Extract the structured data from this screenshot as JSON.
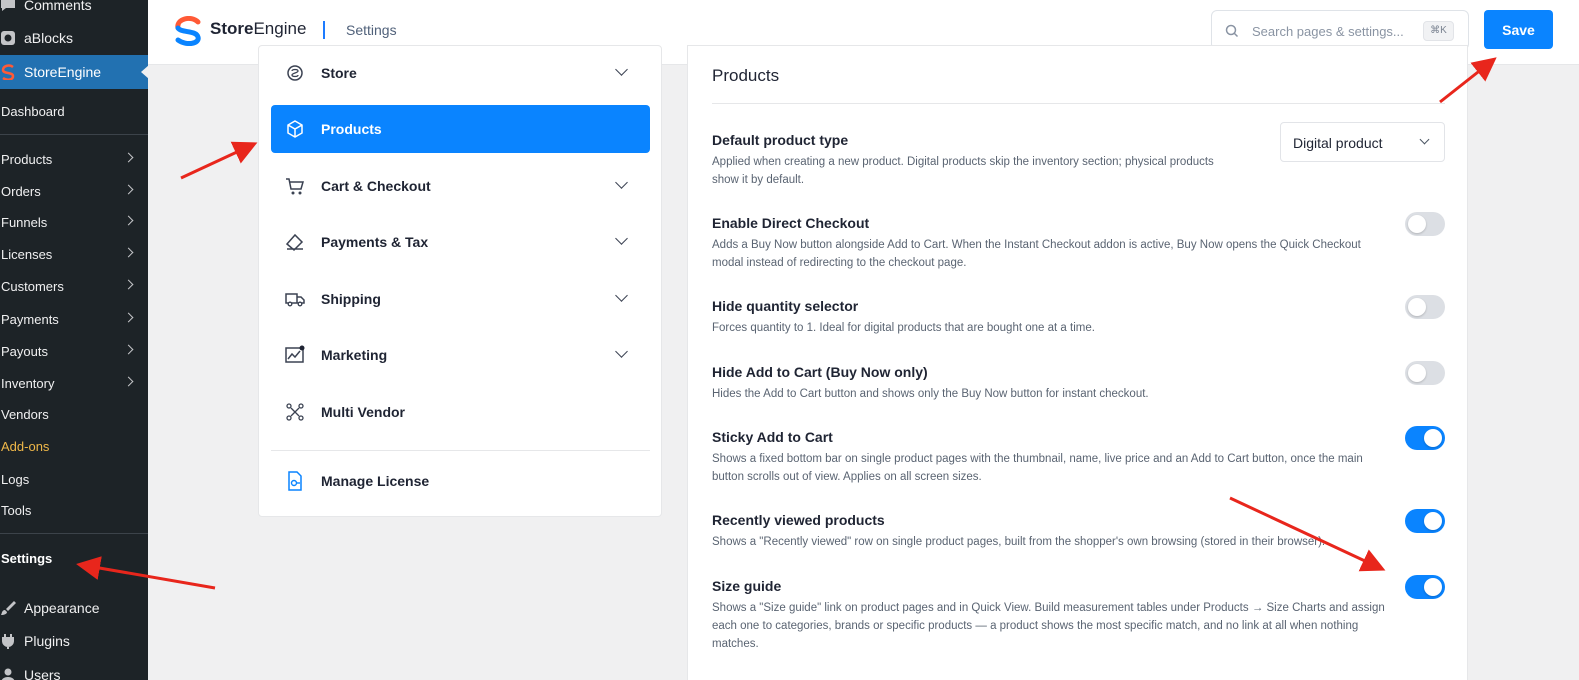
{
  "wp_menu": {
    "comments": "Comments",
    "ablocks": "aBlocks",
    "storeengine": "StoreEngine",
    "dashboard": "Dashboard",
    "products": "Products",
    "orders": "Orders",
    "funnels": "Funnels",
    "licenses": "Licenses",
    "customers": "Customers",
    "payments": "Payments",
    "payouts": "Payouts",
    "inventory": "Inventory",
    "vendors": "Vendors",
    "addons": "Add-ons",
    "logs": "Logs",
    "tools": "Tools",
    "settings": "Settings",
    "appearance": "Appearance",
    "plugins": "Plugins",
    "users": "Users"
  },
  "header": {
    "logo_bold": "Store",
    "logo_rest": "Engine",
    "breadcrumb": "Settings",
    "search_placeholder": "Search pages & settings...",
    "search_shortcut": "⌘K",
    "save_label": "Save"
  },
  "nav": {
    "store": "Store",
    "products": "Products",
    "cart_checkout": "Cart & Checkout",
    "payments_tax": "Payments & Tax",
    "shipping": "Shipping",
    "marketing": "Marketing",
    "multi_vendor": "Multi Vendor",
    "manage_license": "Manage License",
    "active": "products"
  },
  "content": {
    "title": "Products",
    "settings": [
      {
        "title": "Default product type",
        "desc_1": "Applied when creating a new product. Digital products skip the inventory section; physical products",
        "desc_2": "show it by default.",
        "control": "select",
        "value": "Digital product"
      },
      {
        "title": "Enable Direct Checkout",
        "desc_1": "Adds a Buy Now button alongside Add to Cart. When the Instant Checkout addon is active, Buy Now opens the Quick Checkout",
        "desc_2": "modal instead of redirecting to the checkout page.",
        "control": "toggle",
        "on": false
      },
      {
        "title": "Hide quantity selector",
        "desc_1": "Forces quantity to 1. Ideal for digital products that are bought one at a time.",
        "control": "toggle",
        "on": false
      },
      {
        "title": "Hide Add to Cart (Buy Now only)",
        "desc_1": "Hides the Add to Cart button and shows only the Buy Now button for instant checkout.",
        "control": "toggle",
        "on": false
      },
      {
        "title": "Sticky Add to Cart",
        "desc_1": "Shows a fixed bottom bar on single product pages with the thumbnail, name, live price and an Add to Cart button, once the main",
        "desc_2": "button scrolls out of view. Applies on all screen sizes.",
        "control": "toggle",
        "on": true
      },
      {
        "title": "Recently viewed products",
        "desc_1": "Shows a \"Recently viewed\" row on single product pages, built from the shopper's own browsing (stored in their browser).",
        "control": "toggle",
        "on": true
      },
      {
        "title": "Size guide",
        "desc_1": "Shows a \"Size guide\" link on product pages and in Quick View. Build measurement tables under Products → Size Charts and assign",
        "desc_2": "each one to categories, brands or specific products — a product shows the most specific match, and no link at all when nothing",
        "desc_3": "matches.",
        "control": "toggle",
        "on": true
      }
    ]
  },
  "colors": {
    "accent": "#0a84ff",
    "wp_sidebar": "#1d2327",
    "wp_active": "#2271b1",
    "annotation_arrow": "#e8261c",
    "addons": "#f0b849"
  }
}
